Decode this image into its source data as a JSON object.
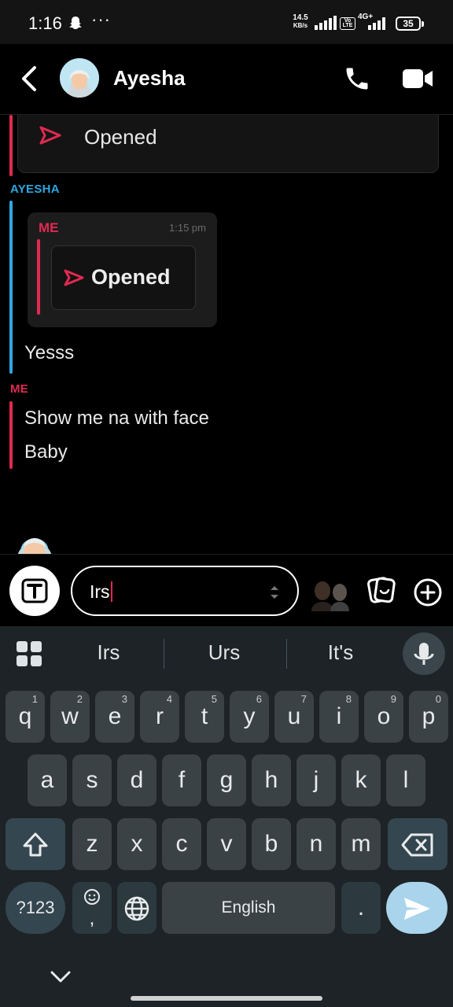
{
  "status_bar": {
    "time": "1:16",
    "dots": "···",
    "speed_value": "14.5",
    "speed_unit": "KB/s",
    "network": "4G+",
    "battery": "35"
  },
  "header": {
    "contact_name": "Ayesha"
  },
  "chat": {
    "snap_status": "Opened",
    "sender_them": "AYESHA",
    "quote_sender": "ME",
    "quote_time": "1:15 pm",
    "quote_status": "Opened",
    "their_message": "Yesss",
    "sender_me": "ME",
    "my_messages": [
      "Show me na with face",
      "Baby"
    ]
  },
  "input": {
    "value": "Irs"
  },
  "keyboard": {
    "suggestions": [
      "Irs",
      "Urs",
      "It's"
    ],
    "row1": [
      {
        "key": "q",
        "hint": "1"
      },
      {
        "key": "w",
        "hint": "2"
      },
      {
        "key": "e",
        "hint": "3"
      },
      {
        "key": "r",
        "hint": "4"
      },
      {
        "key": "t",
        "hint": "5"
      },
      {
        "key": "y",
        "hint": "6"
      },
      {
        "key": "u",
        "hint": "7"
      },
      {
        "key": "i",
        "hint": "8"
      },
      {
        "key": "o",
        "hint": "9"
      },
      {
        "key": "p",
        "hint": "0"
      }
    ],
    "row2": [
      "a",
      "s",
      "d",
      "f",
      "g",
      "h",
      "j",
      "k",
      "l"
    ],
    "row3": [
      "z",
      "x",
      "c",
      "v",
      "b",
      "n",
      "m"
    ],
    "symbols_label": "?123",
    "comma_label": ",",
    "space_label": "English",
    "period_label": "."
  },
  "colors": {
    "accent_red": "#e02a50",
    "accent_blue": "#2fa6e0",
    "keyboard_bg": "#1d2326",
    "key_bg": "#3b4245",
    "enter_bg": "#a9d4ec"
  }
}
